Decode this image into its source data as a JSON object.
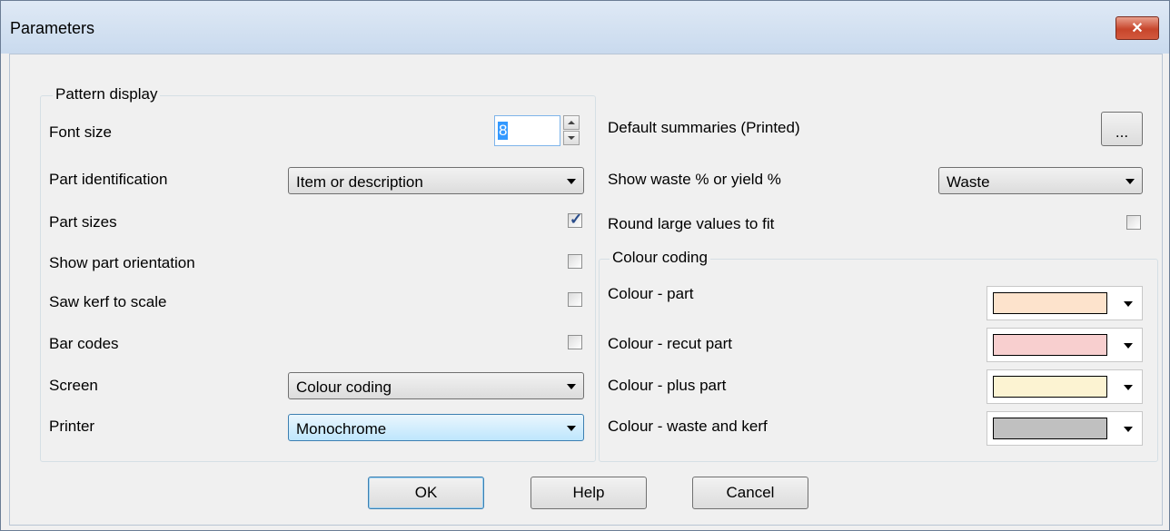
{
  "window": {
    "title": "Parameters"
  },
  "pattern_display": {
    "legend": "Pattern display",
    "font_size": {
      "label": "Font size",
      "value": "8"
    },
    "part_identification": {
      "label": "Part identification",
      "value": "Item or description"
    },
    "part_sizes": {
      "label": "Part sizes",
      "checked": true
    },
    "show_part_orientation": {
      "label": "Show part orientation",
      "checked": false
    },
    "saw_kerf_to_scale": {
      "label": "Saw kerf to scale",
      "checked": false
    },
    "bar_codes": {
      "label": "Bar codes",
      "checked": false
    },
    "screen": {
      "label": "Screen",
      "value": "Colour coding"
    },
    "printer": {
      "label": "Printer",
      "value": "Monochrome"
    }
  },
  "right": {
    "default_summaries": {
      "label": "Default summaries (Printed)",
      "button": "..."
    },
    "waste_yield": {
      "label": "Show waste % or yield %",
      "value": "Waste"
    },
    "round_large": {
      "label": "Round large values to fit",
      "checked": false
    }
  },
  "colour_coding": {
    "legend": "Colour coding",
    "items": [
      {
        "label": "Colour - part",
        "color": "#fde3cc"
      },
      {
        "label": "Colour - recut part",
        "color": "#f8cfcf"
      },
      {
        "label": "Colour - plus part",
        "color": "#fcf3d2"
      },
      {
        "label": "Colour - waste and kerf",
        "color": "#c0c0c0"
      }
    ]
  },
  "buttons": {
    "ok": "OK",
    "help": "Help",
    "cancel": "Cancel"
  }
}
